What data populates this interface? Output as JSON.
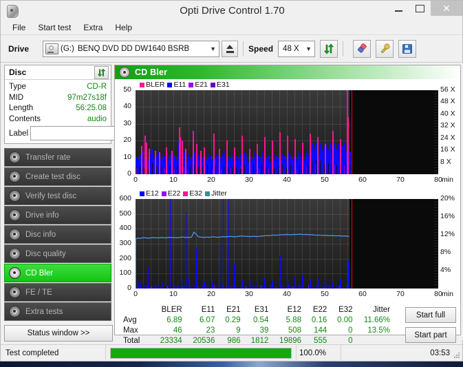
{
  "window": {
    "title": "Opti Drive Control 1.70",
    "icon": "optical-disc-icon",
    "minimize": "–",
    "maximize": "□",
    "close": "✕"
  },
  "menu": [
    "File",
    "Start test",
    "Extra",
    "Help"
  ],
  "toolbar": {
    "drive_label": "Drive",
    "drive_letter": "(G:)",
    "drive_name": "BENQ DVD DD DW1640 BSRB",
    "eject_title": "Eject",
    "speed_label": "Speed",
    "speed_value": "48 X",
    "refresh_icon": "refresh-arrows-icon",
    "erase_icon": "eraser-icon",
    "tools_icon": "tools-icon",
    "save_icon": "save-floppy-icon"
  },
  "disc": {
    "header": "Disc",
    "refresh_icon": "refresh-arrows-icon",
    "rows": [
      {
        "key": "Type",
        "value": "CD-R"
      },
      {
        "key": "MID",
        "value": "97m27s18f"
      },
      {
        "key": "Length",
        "value": "56:25.08"
      },
      {
        "key": "Contents",
        "value": "audio"
      }
    ],
    "label_key": "Label",
    "label_value": "",
    "label_placeholder": "",
    "disc_icon": "cd-disc-icon"
  },
  "nav": {
    "items": [
      {
        "label": "Transfer rate",
        "active": false
      },
      {
        "label": "Create test disc",
        "active": false
      },
      {
        "label": "Verify test disc",
        "active": false
      },
      {
        "label": "Drive info",
        "active": false
      },
      {
        "label": "Disc info",
        "active": false
      },
      {
        "label": "Disc quality",
        "active": false
      },
      {
        "label": "CD Bler",
        "active": true
      },
      {
        "label": "FE / TE",
        "active": false
      },
      {
        "label": "Extra tests",
        "active": false
      }
    ],
    "status_window": "Status window >>"
  },
  "panel": {
    "title": "CD Bler",
    "icon": "cd-disc-icon"
  },
  "actions": {
    "start_full": "Start full",
    "start_part": "Start part"
  },
  "statusbar": {
    "text": "Test completed",
    "percent": "100.0%",
    "progress": 100,
    "time": "03:53"
  },
  "stats": {
    "columns": [
      "BLER",
      "E11",
      "E21",
      "E31",
      "E12",
      "E22",
      "E32",
      "Jitter"
    ],
    "rows": [
      {
        "label": "Avg",
        "values": [
          "6.89",
          "6.07",
          "0.29",
          "0.54",
          "5.88",
          "0.16",
          "0.00",
          "11.66%"
        ]
      },
      {
        "label": "Max",
        "values": [
          "46",
          "23",
          "9",
          "39",
          "508",
          "144",
          "0",
          "13.5%"
        ]
      },
      {
        "label": "Total",
        "values": [
          "23334",
          "20536",
          "986",
          "1812",
          "19896",
          "555",
          "0",
          ""
        ]
      }
    ]
  },
  "chart_data": [
    {
      "type": "area",
      "name": "bler-chart",
      "title": "CD Bler",
      "xlabel": "min",
      "ylabel": "",
      "xlim": [
        0,
        80
      ],
      "ylim": [
        0,
        50
      ],
      "yticks": [
        0,
        10,
        20,
        30,
        40,
        50
      ],
      "xticks": [
        0,
        10,
        20,
        30,
        40,
        50,
        60,
        70,
        80
      ],
      "right_axis": {
        "label": "X",
        "ticks": [
          "8 X",
          "16 X",
          "24 X",
          "32 X",
          "40 X",
          "48 X",
          "56 X"
        ],
        "lim": [
          0,
          56
        ]
      },
      "grid": true,
      "legend_position": "top-left",
      "legend": [
        {
          "name": "BLER",
          "color": "#ff1493"
        },
        {
          "name": "E11",
          "color": "#0000ff"
        },
        {
          "name": "E21",
          "color": "#9900ff"
        },
        {
          "name": "E31",
          "color": "#6600cc"
        }
      ],
      "data_end_min": 56.5,
      "end_marker_min": 57.0,
      "end_marker_color": "#ff0000",
      "series": [
        {
          "name": "E11",
          "color": "#0000ff",
          "comment": "base band, blue, roughly 4-12 with occasional peaks to ~23",
          "values": [
            10,
            8,
            9,
            12,
            11,
            7,
            14,
            9,
            8,
            11,
            13,
            9,
            7,
            10,
            12,
            8,
            15,
            9,
            10,
            7,
            11,
            13,
            8,
            9,
            12,
            10,
            7,
            11,
            9,
            14,
            10,
            8,
            12,
            9,
            7,
            13,
            10,
            11,
            8,
            9,
            12,
            20,
            10,
            9,
            8,
            11,
            13,
            9,
            7,
            10,
            12,
            8,
            9,
            11,
            10,
            7,
            13,
            9,
            8,
            12,
            10,
            9,
            11,
            7,
            10,
            13,
            8,
            9,
            12,
            10,
            7,
            11,
            9,
            8,
            13,
            10,
            12,
            9,
            7,
            11,
            10,
            8,
            12,
            9,
            10,
            13,
            7,
            11,
            9,
            8,
            10,
            12,
            9,
            7,
            13,
            11,
            8,
            10,
            9,
            12,
            7,
            11,
            10,
            8,
            13,
            9,
            12,
            7,
            10,
            11,
            8,
            9,
            13,
            10,
            7,
            12,
            9,
            11,
            8,
            10,
            13,
            7,
            9,
            12,
            10,
            8,
            11,
            9,
            7,
            13,
            10,
            12,
            8,
            9,
            11,
            7,
            10,
            13,
            9,
            8,
            12,
            10,
            11,
            7,
            9,
            13,
            8,
            10,
            12,
            9,
            7,
            11,
            10,
            8,
            13,
            9,
            12,
            10,
            8,
            11,
            7,
            9,
            13,
            10,
            12,
            8,
            14,
            16,
            18,
            15,
            13,
            17,
            19,
            14,
            12,
            16,
            18,
            15,
            13,
            17,
            14,
            19,
            16,
            12,
            15,
            18,
            13,
            17,
            14,
            16,
            19,
            15,
            12,
            18,
            14,
            16,
            13,
            17,
            15,
            19,
            14,
            12,
            16,
            18,
            13
          ]
        },
        {
          "name": "BLER",
          "color": "#ff1493",
          "comment": "magenta spikes above the blue band, max 46",
          "spikes": [
            {
              "min": 1.5,
              "value": 17
            },
            {
              "min": 2.3,
              "value": 23
            },
            {
              "min": 2.8,
              "value": 19
            },
            {
              "min": 3.5,
              "value": 15
            },
            {
              "min": 5.0,
              "value": 14
            },
            {
              "min": 6.2,
              "value": 13
            },
            {
              "min": 8.0,
              "value": 16
            },
            {
              "min": 9.5,
              "value": 14
            },
            {
              "min": 11.4,
              "value": 28
            },
            {
              "min": 11.6,
              "value": 22
            },
            {
              "min": 12.2,
              "value": 20
            },
            {
              "min": 13.0,
              "value": 15
            },
            {
              "min": 15.0,
              "value": 26
            },
            {
              "min": 16.0,
              "value": 18
            },
            {
              "min": 17.0,
              "value": 14
            },
            {
              "min": 18.0,
              "value": 16
            },
            {
              "min": 20.5,
              "value": 24
            },
            {
              "min": 22.0,
              "value": 15
            },
            {
              "min": 24.0,
              "value": 20
            },
            {
              "min": 26.0,
              "value": 16
            },
            {
              "min": 28.0,
              "value": 23
            },
            {
              "min": 30.0,
              "value": 15
            },
            {
              "min": 32.0,
              "value": 18
            },
            {
              "min": 34.0,
              "value": 22
            },
            {
              "min": 36.0,
              "value": 20
            },
            {
              "min": 38.0,
              "value": 25
            },
            {
              "min": 40.0,
              "value": 23
            },
            {
              "min": 42.0,
              "value": 21
            },
            {
              "min": 44.0,
              "value": 19
            },
            {
              "min": 46.0,
              "value": 24
            },
            {
              "min": 48.0,
              "value": 22
            },
            {
              "min": 50.0,
              "value": 18
            },
            {
              "min": 52.0,
              "value": 26
            },
            {
              "min": 54.0,
              "value": 21
            },
            {
              "min": 56.0,
              "value": 34
            }
          ]
        }
      ]
    },
    {
      "type": "line",
      "name": "e12-jitter-chart",
      "title": "",
      "xlabel": "min",
      "ylabel": "",
      "xlim": [
        0,
        80
      ],
      "ylim": [
        0,
        600
      ],
      "yticks": [
        0,
        100,
        200,
        300,
        400,
        500,
        600
      ],
      "xticks": [
        0,
        10,
        20,
        30,
        40,
        50,
        60,
        70,
        80
      ],
      "right_axis": {
        "label": "%",
        "ticks": [
          "4%",
          "8%",
          "12%",
          "16%",
          "20%"
        ],
        "lim": [
          0,
          20
        ]
      },
      "grid": true,
      "legend_position": "top-left",
      "legend": [
        {
          "name": "E12",
          "color": "#0000ff"
        },
        {
          "name": "E22",
          "color": "#9900ff"
        },
        {
          "name": "E32",
          "color": "#ff1493"
        },
        {
          "name": "Jitter",
          "color": "#3a8f8f"
        }
      ],
      "data_end_min": 56.5,
      "end_marker_min": 57.0,
      "end_marker_color": "#ff0000",
      "series": [
        {
          "name": "Jitter",
          "color": "#5599ee",
          "comment": "light blue trace, scale right axis %; ~11.3% rising to ~12.1%",
          "values": [
            11.0,
            11.3,
            11.2,
            11.3,
            11.35,
            11.3,
            11.25,
            11.3,
            11.4,
            11.3,
            11.35,
            11.3,
            11.4,
            11.35,
            11.3,
            11.4,
            11.45,
            11.35,
            11.4,
            11.3,
            11.4,
            11.45,
            11.5,
            11.4,
            11.45,
            11.4,
            11.5,
            12.6,
            12.2,
            11.6,
            11.5,
            11.45,
            11.4,
            11.5,
            11.45,
            11.5,
            11.55,
            11.5,
            11.45,
            11.5,
            11.55,
            11.6,
            11.55,
            11.6,
            11.65,
            11.6,
            11.55,
            11.6,
            11.7,
            11.75,
            11.7,
            11.65,
            11.7,
            11.6,
            11.65,
            11.7,
            11.6,
            11.65,
            11.7,
            11.75,
            11.8,
            11.85,
            11.8,
            11.9,
            11.95,
            11.9,
            11.95,
            12.0,
            12.05,
            12.0,
            12.1,
            12.05,
            12.0,
            12.1,
            12.05,
            12.1,
            12.15,
            12.1,
            12.05,
            12.1,
            12.0,
            12.05,
            12.0,
            11.95,
            11.9,
            11.95,
            11.9,
            11.85,
            11.9,
            11.85,
            11.8,
            11.85,
            11.8,
            11.75,
            11.8,
            11.75,
            11.7,
            11.75,
            11.7,
            11.65
          ]
        },
        {
          "name": "E12",
          "color": "#0000ff",
          "comment": "blue spikes from baseline, max 508",
          "spikes": [
            {
              "min": 0.5,
              "value": 60
            },
            {
              "min": 1.2,
              "value": 45
            },
            {
              "min": 2.0,
              "value": 30
            },
            {
              "min": 3.2,
              "value": 150
            },
            {
              "min": 5.0,
              "value": 35
            },
            {
              "min": 7.0,
              "value": 40
            },
            {
              "min": 9.0,
              "value": 600
            },
            {
              "min": 11.0,
              "value": 50
            },
            {
              "min": 12.0,
              "value": 60
            },
            {
              "min": 13.2,
              "value": 508
            },
            {
              "min": 14.0,
              "value": 70
            },
            {
              "min": 16.0,
              "value": 270
            },
            {
              "min": 18.0,
              "value": 45
            },
            {
              "min": 20.0,
              "value": 50
            },
            {
              "min": 22.5,
              "value": 300
            },
            {
              "min": 23.0,
              "value": 600
            },
            {
              "min": 24.5,
              "value": 600
            },
            {
              "min": 26.0,
              "value": 160
            },
            {
              "min": 28.0,
              "value": 55
            },
            {
              "min": 30.0,
              "value": 60
            },
            {
              "min": 32.0,
              "value": 45
            },
            {
              "min": 34.0,
              "value": 70
            },
            {
              "min": 36.0,
              "value": 50
            },
            {
              "min": 38.0,
              "value": 220
            },
            {
              "min": 40.0,
              "value": 60
            },
            {
              "min": 42.0,
              "value": 80
            },
            {
              "min": 44.0,
              "value": 90
            },
            {
              "min": 46.0,
              "value": 55
            },
            {
              "min": 48.0,
              "value": 75
            },
            {
              "min": 50.0,
              "value": 60
            },
            {
              "min": 52.0,
              "value": 50
            },
            {
              "min": 54.0,
              "value": 65
            },
            {
              "min": 56.2,
              "value": 185
            }
          ]
        }
      ]
    }
  ]
}
